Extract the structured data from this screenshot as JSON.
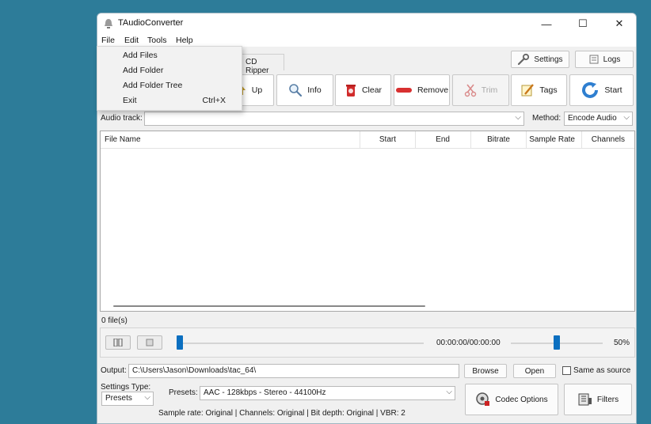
{
  "window": {
    "title": "TAudioConverter",
    "minimize_glyph": "—",
    "maximize_glyph": "☐",
    "close_glyph": "✕"
  },
  "menubar": {
    "items": [
      "File",
      "Edit",
      "Tools",
      "Help"
    ]
  },
  "file_menu": {
    "items": [
      {
        "label": "Add Files",
        "shortcut": ""
      },
      {
        "label": "Add Folder",
        "shortcut": ""
      },
      {
        "label": "Add Folder Tree",
        "shortcut": ""
      },
      {
        "label": "Exit",
        "shortcut": "Ctrl+X"
      }
    ]
  },
  "tabs": {
    "cd_ripper": "CD Ripper"
  },
  "top_buttons": {
    "settings": "Settings",
    "logs": "Logs"
  },
  "toolbar": {
    "up": "Up",
    "info": "Info",
    "clear": "Clear",
    "remove": "Remove",
    "trim": "Trim",
    "tags": "Tags",
    "start": "Start"
  },
  "audio_track": {
    "label": "Audio track:",
    "value": ""
  },
  "method": {
    "label": "Method:",
    "value": "Encode Audio"
  },
  "file_list": {
    "columns": [
      "File Name",
      "Start",
      "End",
      "Bitrate",
      "Sample Rate",
      "Channels"
    ]
  },
  "file_count": "0 file(s)",
  "player": {
    "time": "00:00:00/00:00:00",
    "volume": "50%",
    "volume_level": 0.5,
    "position_level": 0.0
  },
  "output": {
    "label": "Output:",
    "path": "C:\\Users\\Jason\\Downloads\\tac_64\\",
    "browse": "Browse",
    "open": "Open",
    "same_as_source": "Same as source"
  },
  "settings_type": {
    "label": "Settings Type:",
    "value": "Presets"
  },
  "presets": {
    "label": "Presets:",
    "value": "AAC - 128kbps - Stereo - 44100Hz"
  },
  "buttons": {
    "codec_options": "Codec Options",
    "filters": "Filters"
  },
  "status_line": "Sample rate: Original | Channels: Original | Bit depth: Original | VBR: 2",
  "colors": {
    "desktop": "#2d7c99",
    "accent": "#0b6fc0"
  }
}
